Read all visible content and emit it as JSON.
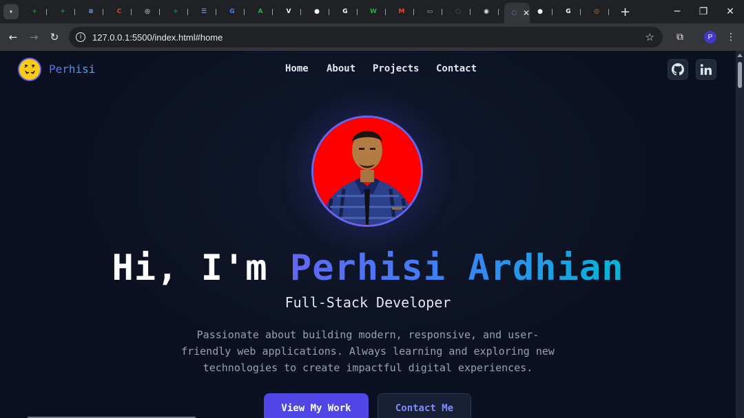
{
  "browser": {
    "tabs": [
      {
        "icon": "sheets-icon",
        "color": "#1e8e3e",
        "glyph": "+"
      },
      {
        "icon": "sheets-icon",
        "color": "#1e8e3e",
        "glyph": "+"
      },
      {
        "icon": "docs-icon",
        "color": "#8ab4f8",
        "glyph": "≡"
      },
      {
        "icon": "app-icon",
        "color": "#ea4335",
        "glyph": "C"
      },
      {
        "icon": "openai-icon",
        "color": "#ffffff",
        "glyph": "◎"
      },
      {
        "icon": "sheets-icon",
        "color": "#1e8e3e",
        "glyph": "+"
      },
      {
        "icon": "list-icon",
        "color": "#8ab4f8",
        "glyph": "☰"
      },
      {
        "icon": "translate-icon",
        "color": "#4285f4",
        "glyph": "G"
      },
      {
        "icon": "app-icon",
        "color": "#34a853",
        "glyph": "A"
      },
      {
        "icon": "vercel-icon",
        "color": "#ffffff",
        "glyph": "V"
      },
      {
        "icon": "github-icon",
        "color": "#ffffff",
        "glyph": "●"
      },
      {
        "icon": "google-icon",
        "color": "#ffffff",
        "glyph": "G"
      },
      {
        "icon": "word-icon",
        "color": "#34a853",
        "glyph": "W"
      },
      {
        "icon": "gmail-icon",
        "color": "#ea4335",
        "glyph": "M"
      },
      {
        "icon": "screen-icon",
        "color": "#8ab4f8",
        "glyph": "▭"
      },
      {
        "icon": "loading-icon",
        "color": "#5f6368",
        "glyph": "○"
      },
      {
        "icon": "app-icon",
        "color": "#e8eaed",
        "glyph": "◉"
      }
    ],
    "active_tab": {
      "icon": "live-server-icon",
      "close": "✕"
    },
    "after_tabs": [
      {
        "icon": "github-icon",
        "color": "#ffffff",
        "glyph": "●"
      },
      {
        "icon": "google-icon",
        "color": "#ffffff",
        "glyph": "G"
      },
      {
        "icon": "app-icon",
        "color": "#f97316",
        "glyph": "◎"
      }
    ],
    "new_tab": "+",
    "window": {
      "minimize": "─",
      "restore": "❐",
      "close": "✕"
    },
    "url": "127.0.0.1:5500/index.html#home",
    "profile_initial": "P"
  },
  "site": {
    "brand": "Perhisi",
    "nav": [
      "Home",
      "About",
      "Projects",
      "Contact"
    ],
    "social": [
      "github-icon",
      "linkedin-icon"
    ]
  },
  "hero": {
    "greeting": "Hi, I'm ",
    "name": "Perhisi Ardhian",
    "subtitle": "Full-Stack Developer",
    "description": "Passionate about building modern, responsive, and user-friendly web applications. Always learning and exploring new technologies to create impactful digital experiences.",
    "primary_button": "View My Work",
    "secondary_button": "Contact Me"
  },
  "colors": {
    "background": "#0b1120",
    "accent": "#4f46e5",
    "gradient_start": "#6366f1",
    "gradient_end": "#06b6d4",
    "avatar_bg": "#ff0000"
  }
}
